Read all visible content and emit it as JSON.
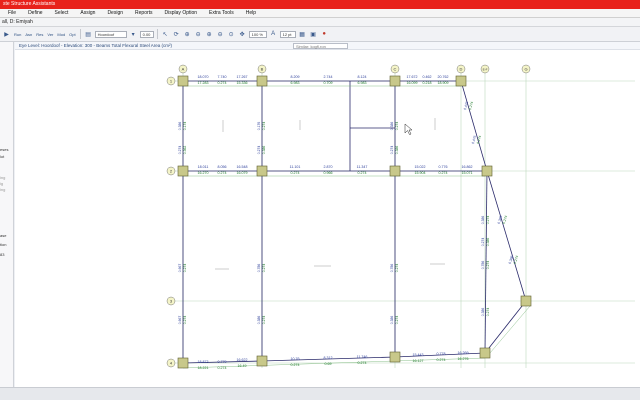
{
  "app": {
    "title": "ste Structure Assistants"
  },
  "menu": [
    "File",
    "Define",
    "Select",
    "Assign",
    "Design",
    "Reports",
    "Display Option",
    "Extra Tools",
    "Help"
  ],
  "user_info": "all, D: Emiyah",
  "toolbar": {
    "story_value": "Hoordoof",
    "elev_value": "0.00",
    "zoom_value": "100 %",
    "font_value": "12 pt",
    "run_label": "Run",
    "asn_label": "Asn",
    "res_label": "Res",
    "ver_label": "Ver",
    "mod_label": "Mod",
    "opt_label": "Opt"
  },
  "canvas": {
    "header": "Eye Level: Hoordoof - Elevation: 300 - Beams Total Flexural Steel Area (cm²)",
    "filter_placeholder": "Similar: kogfl,ron"
  },
  "left_panel": {
    "items": [
      "eses",
      "lot",
      "ing",
      "ig",
      "ing",
      "ase",
      "tion",
      "83"
    ]
  },
  "grid": {
    "columns": [
      "A",
      "B",
      "C",
      "D",
      "E-F",
      "G"
    ],
    "rows": [
      "1",
      "2",
      "3",
      "4"
    ]
  },
  "beam_labels": {
    "row1": [
      {
        "top": "18.070",
        "bot": "17.283"
      },
      {
        "top": "7.740",
        "bot": "0.274"
      },
      {
        "top": "17.267",
        "bot": "15.336"
      },
      {
        "top": "8.209",
        "bot": "6.983"
      },
      {
        "top": "2.744",
        "bot": "0.709"
      },
      {
        "top": "8.124",
        "bot": "6.983"
      },
      {
        "top": "17.672",
        "bot": "16.099"
      },
      {
        "top": "0.462",
        "bot": "0.218"
      },
      {
        "top": "20.762",
        "bot": "18.909"
      }
    ],
    "row2": [
      {
        "top": "18.011",
        "bot": "16.270"
      },
      {
        "top": "8.056",
        "bot": "0.274"
      },
      {
        "top": "16.548",
        "bot": "16.079"
      },
      {
        "top": "11.101",
        "bot": "0.274"
      },
      {
        "top": "2.870",
        "bot": "0.966"
      },
      {
        "top": "11.347",
        "bot": "0.274"
      },
      {
        "top": "15.022",
        "bot": "15.904"
      },
      {
        "top": "0.776",
        "bot": "0.274"
      },
      {
        "top": "16.862",
        "bot": "15.071"
      }
    ],
    "row4": [
      {
        "top": "18.873",
        "bot": "18.221"
      },
      {
        "top": "0.779",
        "bot": "0.274"
      },
      {
        "top": "16.622",
        "bot": "16.49"
      },
      {
        "top": "10.76",
        "bot": "0.274"
      },
      {
        "top": "8.312",
        "bot": "0.69"
      },
      {
        "top": "11.746",
        "bot": "0.274"
      },
      {
        "top": "15.443",
        "bot": "16.127"
      },
      {
        "top": "0.778",
        "bot": "0.274"
      },
      {
        "top": "16.269",
        "bot": "16.276"
      }
    ],
    "colA": [
      "0.386",
      "0.174",
      "0.274",
      "0.362",
      "0.667",
      "0.274",
      "0.667",
      "0.274"
    ],
    "colB": [
      "0.176",
      "0.274",
      "0.274",
      "0.386",
      "0.786",
      "0.274",
      "0.386",
      "0.274"
    ],
    "colC": [
      "0.386",
      "0.274",
      "0.274",
      "0.386",
      "0.786",
      "0.274",
      "0.386",
      "0.274"
    ],
    "colE": [
      "0.386",
      "0.274",
      "0.274",
      "0.386",
      "0.786",
      "0.274",
      "0.386",
      "0.274"
    ],
    "diag1": [
      "0.476",
      "0.274",
      "0.476",
      "0.274"
    ],
    "diag2": [
      "0.386",
      "0.274",
      "0.386",
      "0.274"
    ]
  },
  "colors": {
    "title_bar": "#e8221b",
    "column": "#c8c88a",
    "beam": "#2a2a6a",
    "label_blue": "#2d3f9a",
    "label_green": "#1d7a2a",
    "grid_line": "#bcd8bc"
  }
}
